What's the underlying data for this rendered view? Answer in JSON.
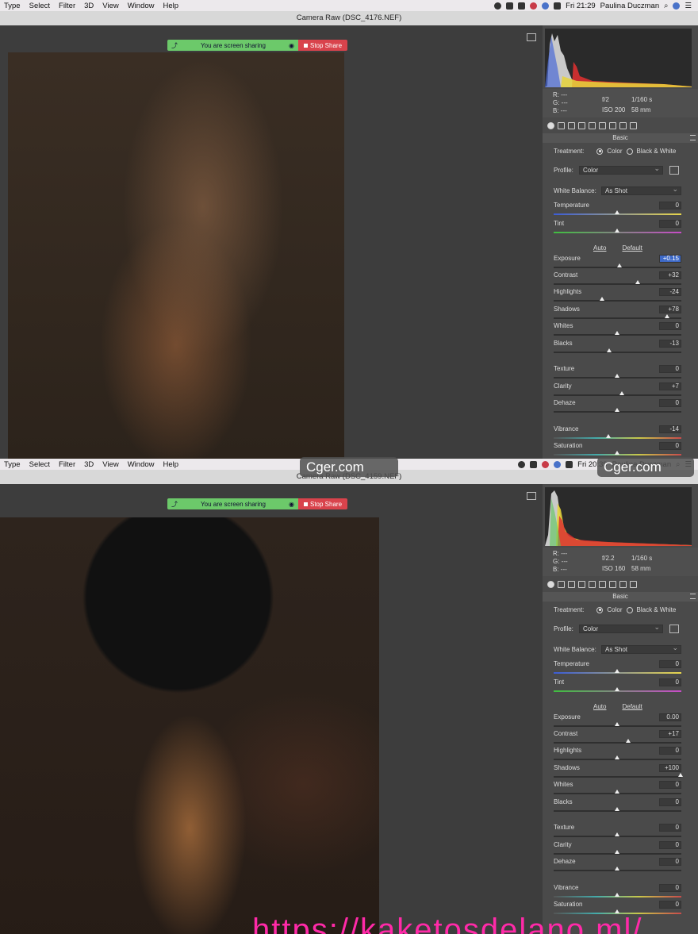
{
  "menubar": {
    "items": [
      "Type",
      "Select",
      "Filter",
      "3D",
      "View",
      "Window",
      "Help"
    ],
    "top_clock": "Fri 21:29",
    "bottom_clock": "Fri 20:39",
    "user": "Paulina Duczman"
  },
  "sharing": {
    "status": "You are screen sharing",
    "stop_label": "Stop Share"
  },
  "top": {
    "title": "Camera Raw (DSC_4176.NEF)",
    "readout": {
      "r": "R:  ---",
      "g": "G:  ---",
      "b": "B:  ---",
      "aperture": "f/2",
      "shutter": "1/160 s",
      "iso": "ISO 200",
      "focal": "58 mm"
    },
    "sliders": {
      "temperature": "0",
      "tint": "0",
      "exposure": "+0.15",
      "contrast": "+32",
      "highlights": "-24",
      "shadows": "+78",
      "whites": "0",
      "blacks": "-13",
      "texture": "0",
      "clarity": "+7",
      "dehaze": "0",
      "vibrance": "-14",
      "saturation": "0"
    }
  },
  "bottom": {
    "title": "Camera Raw (DSC_4159.NEF)",
    "readout": {
      "r": "R:  ---",
      "g": "G:  ---",
      "b": "B:  ---",
      "aperture": "f/2.2",
      "shutter": "1/160 s",
      "iso": "ISO 160",
      "focal": "58 mm"
    },
    "sliders": {
      "temperature": "0",
      "tint": "0",
      "exposure": "0.00",
      "contrast": "+17",
      "highlights": "0",
      "shadows": "+100",
      "whites": "0",
      "blacks": "0",
      "texture": "0",
      "clarity": "0",
      "dehaze": "0",
      "vibrance": "0",
      "saturation": "0"
    }
  },
  "panel": {
    "section": "Basic",
    "treatment_label": "Treatment:",
    "color_option": "Color",
    "bw_option": "Black & White",
    "profile_label": "Profile:",
    "profile_value": "Color",
    "wb_label": "White Balance:",
    "wb_value": "As Shot",
    "auto_label": "Auto",
    "default_label": "Default",
    "labels": {
      "temperature": "Temperature",
      "tint": "Tint",
      "exposure": "Exposure",
      "contrast": "Contrast",
      "highlights": "Highlights",
      "shadows": "Shadows",
      "whites": "Whites",
      "blacks": "Blacks",
      "texture": "Texture",
      "clarity": "Clarity",
      "dehaze": "Dehaze",
      "vibrance": "Vibrance",
      "saturation": "Saturation"
    }
  },
  "watermark": "Cger.com",
  "url_overlay": "https://kaketosdelano.ml/"
}
